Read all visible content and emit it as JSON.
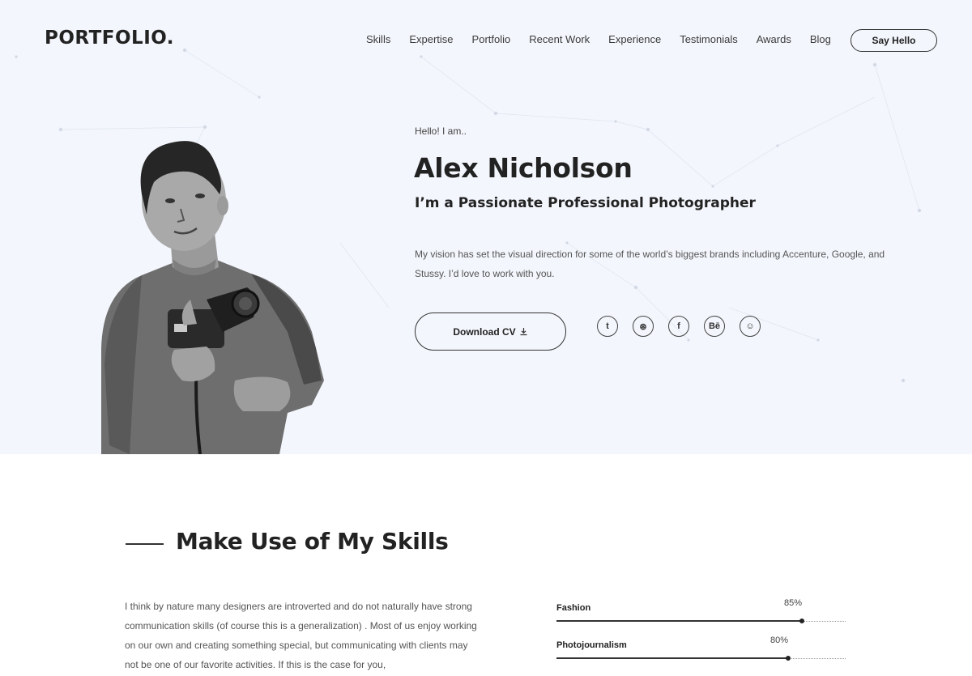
{
  "header": {
    "logo": "PORTFOLIO.",
    "nav": [
      "Skills",
      "Expertise",
      "Portfolio",
      "Recent Work",
      "Experience",
      "Testimonials",
      "Awards",
      "Blog"
    ],
    "cta": "Say Hello"
  },
  "hero": {
    "greeting": "Hello! I am..",
    "name": "Alex Nicholson",
    "tagline": "I’m a Passionate Professional Photographer",
    "bio": "My vision has set the visual direction for some of the world’s biggest brands including Accenture, Google, and Stussy. I’d love to work with you.",
    "download_label": "Download CV",
    "download_icon": "download-icon",
    "socials": [
      {
        "name": "twitter-icon",
        "glyph": "t"
      },
      {
        "name": "dribbble-icon",
        "glyph": "⊛"
      },
      {
        "name": "facebook-icon",
        "glyph": "f"
      },
      {
        "name": "behance-icon",
        "glyph": "Bē"
      },
      {
        "name": "github-icon",
        "glyph": "☺"
      }
    ]
  },
  "skills": {
    "title": "Make Use of My Skills",
    "text": "I think by nature many designers are introverted and do not naturally have strong communication skills (of course this is a generalization) . Most of us enjoy working on our own and creating something special, but communicating with clients may not be one of our favorite activities. If this is the case for you,",
    "items": [
      {
        "label": "Fashion",
        "percent_text": "85%",
        "value": 0.85
      },
      {
        "label": "Photojournalism",
        "percent_text": "80%",
        "value": 0.8
      }
    ]
  },
  "colors": {
    "hero_bg": "#f3f6fc",
    "text": "#222222",
    "accent": "#333333"
  }
}
